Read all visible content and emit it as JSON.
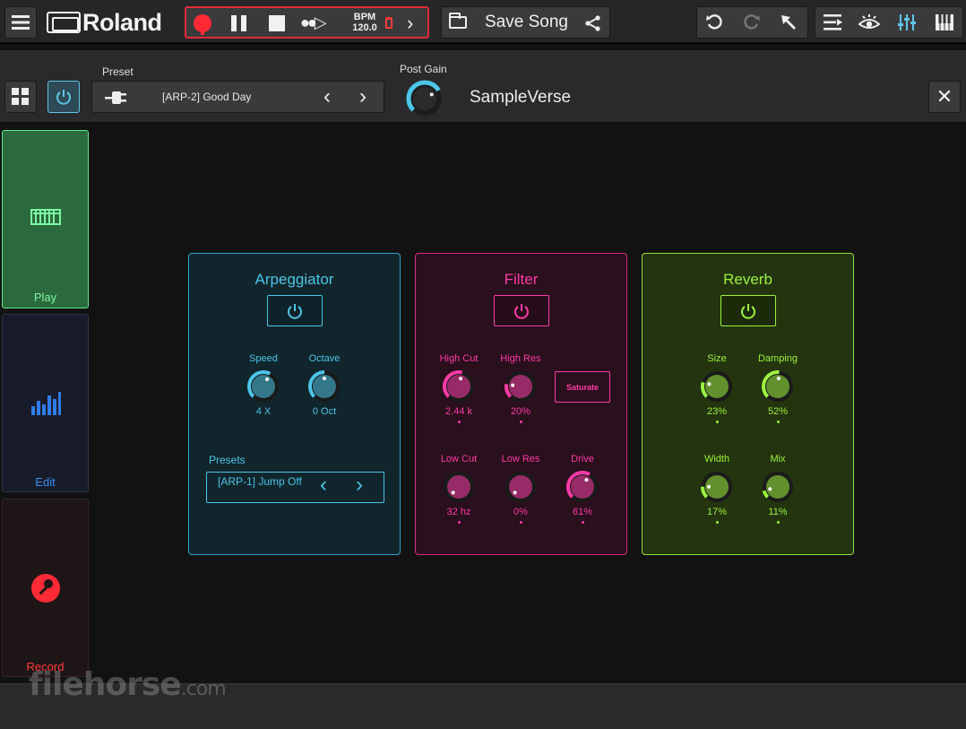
{
  "app": {
    "brand": "Roland"
  },
  "transport": {
    "bpm_label": "BPM",
    "bpm_value": "120.0"
  },
  "song": {
    "save_label": "Save Song"
  },
  "preset_bar": {
    "preset_label": "Preset",
    "preset_name": "[ARP-2] Good Day",
    "post_gain_label": "Post Gain",
    "post_gain_level": 0.72,
    "instrument_name": "SampleVerse"
  },
  "nav": {
    "play_label": "Play",
    "edit_label": "Edit",
    "record_label": "Record"
  },
  "colors": {
    "arpeggiator": "#4cc5e8",
    "filter": "#ff3aa8",
    "reverb": "#9cf23e",
    "record": "#ff2a36"
  },
  "arpeggiator": {
    "title": "Arpeggiator",
    "knobs": [
      {
        "label": "Speed",
        "value": "4 X",
        "level": 0.6
      },
      {
        "label": "Octave",
        "value": "0 Oct",
        "level": 0.5
      }
    ],
    "presets_label": "Presets",
    "preset_name": "[ARP-1] Jump Off"
  },
  "filter": {
    "title": "Filter",
    "knobs": [
      {
        "label": "High Cut",
        "value": "2.44 k",
        "level": 0.55
      },
      {
        "label": "High Res",
        "value": "20%",
        "level": 0.2
      },
      {
        "label": "Low Cut",
        "value": "32 hz",
        "level": 0.0
      },
      {
        "label": "Low Res",
        "value": "0%",
        "level": 0.0
      },
      {
        "label": "Drive",
        "value": "61%",
        "level": 0.61
      }
    ],
    "saturate_label": "Saturate"
  },
  "reverb": {
    "title": "Reverb",
    "knobs": [
      {
        "label": "Size",
        "value": "23%",
        "level": 0.23
      },
      {
        "label": "Damping",
        "value": "52%",
        "level": 0.52
      },
      {
        "label": "Width",
        "value": "17%",
        "level": 0.17
      },
      {
        "label": "Mix",
        "value": "11%",
        "level": 0.11
      }
    ]
  },
  "watermark": {
    "text": "filehorse",
    "suffix": ".com"
  }
}
